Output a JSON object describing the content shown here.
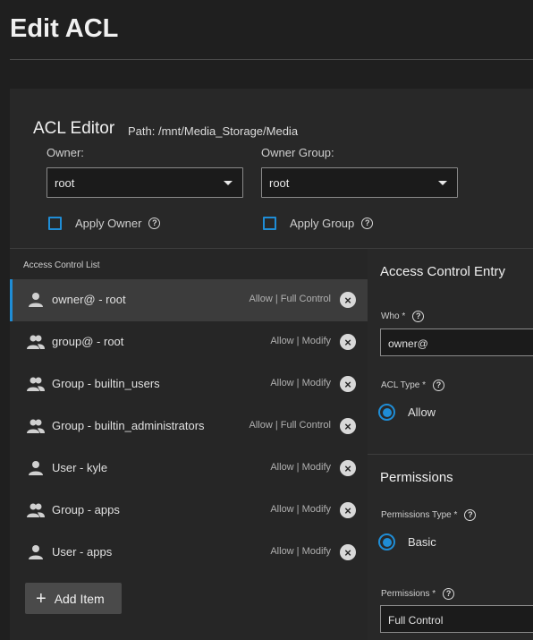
{
  "page": {
    "title": "Edit ACL"
  },
  "editor": {
    "title": "ACL Editor",
    "path_label": "Path:  /mnt/Media_Storage/Media",
    "owner": {
      "label": "Owner:",
      "value": "root",
      "apply_label": "Apply Owner"
    },
    "owner_group": {
      "label": "Owner Group:",
      "value": "root",
      "apply_label": "Apply Group"
    }
  },
  "acl_list": {
    "title": "Access Control List",
    "items": [
      {
        "name": "owner@ - root",
        "perm": "Allow | Full Control",
        "icon": "user-icon",
        "selected": true
      },
      {
        "name": "group@ - root",
        "perm": "Allow | Modify",
        "icon": "group-icon",
        "selected": false
      },
      {
        "name": "Group - builtin_users",
        "perm": "Allow | Modify",
        "icon": "group-icon",
        "selected": false
      },
      {
        "name": "Group - builtin_administrators",
        "perm": "Allow | Full Control",
        "icon": "group-icon",
        "selected": false
      },
      {
        "name": "User - kyle",
        "perm": "Allow | Modify",
        "icon": "user-icon",
        "selected": false
      },
      {
        "name": "Group - apps",
        "perm": "Allow | Modify",
        "icon": "group-icon",
        "selected": false
      },
      {
        "name": "User - apps",
        "perm": "Allow | Modify",
        "icon": "user-icon",
        "selected": false
      }
    ],
    "add_label": "Add Item"
  },
  "entry": {
    "title": "Access Control Entry",
    "who_label": "Who *",
    "who_value": "owner@",
    "acl_type_label": "ACL Type *",
    "acl_type_value": "Allow"
  },
  "permissions": {
    "title": "Permissions",
    "type_label": "Permissions Type *",
    "type_value": "Basic",
    "perms_label": "Permissions *",
    "perms_value": "Full Control"
  },
  "colors": {
    "accent": "#1f8dd6",
    "background": "#1f1f1f",
    "card": "#282828",
    "selected_row": "#3c3c3c"
  }
}
